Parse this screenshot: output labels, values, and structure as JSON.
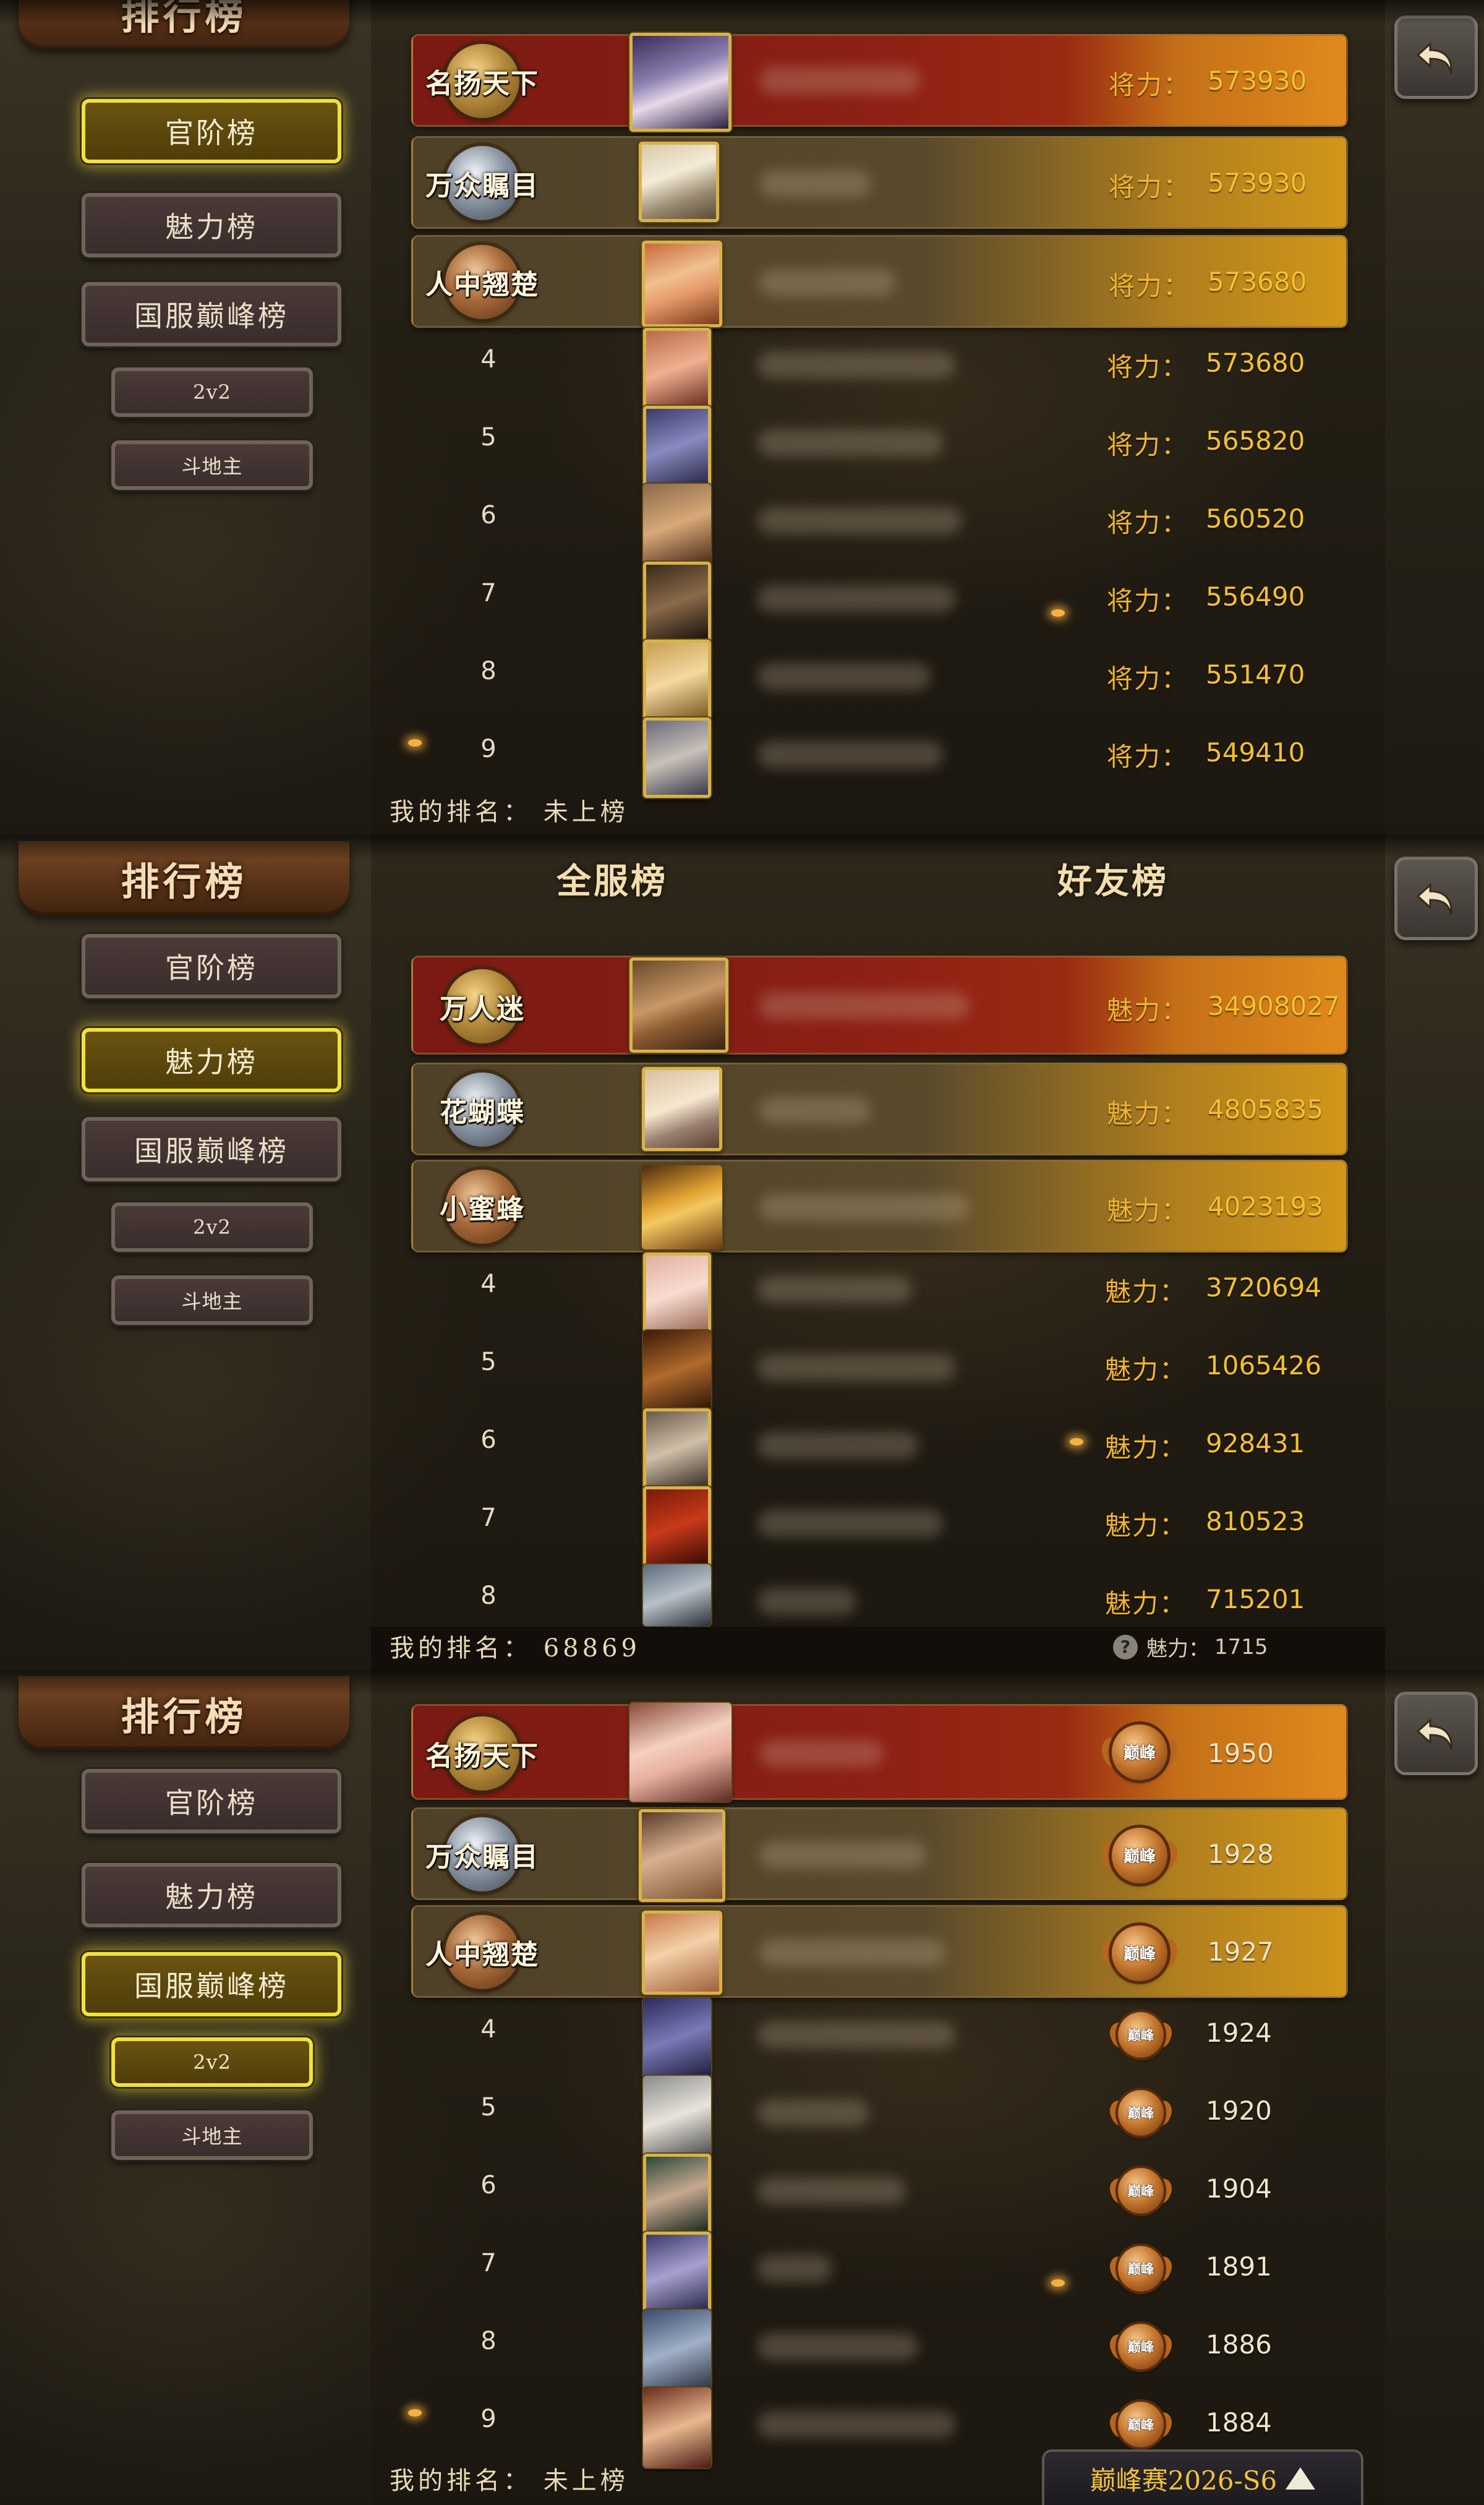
{
  "common": {
    "title": "排行榜",
    "nav": [
      "官阶榜",
      "魅力榜",
      "国服巅峰榜",
      "2v2",
      "斗地主"
    ]
  },
  "panel1": {
    "active": 0,
    "label": "将力：",
    "top_medals": [
      "名扬天下",
      "万众瞩目",
      "人中翘楚"
    ],
    "values": [
      "573930",
      "573930",
      "573680",
      "573680",
      "565820",
      "560520",
      "556490",
      "551470",
      "549410"
    ],
    "my_rank_label": "我的排名：",
    "my_rank_value": "未上榜"
  },
  "panel2": {
    "active": 1,
    "tabs": [
      "全服榜",
      "好友榜"
    ],
    "label": "魅力：",
    "top_medals": [
      "万人迷",
      "花蝴蝶",
      "小蜜蜂"
    ],
    "values": [
      "34908027",
      "4805835",
      "4023193",
      "3720694",
      "1065426",
      "928431",
      "810523",
      "715201"
    ],
    "my_rank_label": "我的排名：",
    "my_rank_value": "68869",
    "footer_charm_label": "魅力：",
    "footer_charm_value": "1715",
    "help_icon": "?"
  },
  "panel3": {
    "active": 2,
    "active_sub": 3,
    "badge_text": "巅峰",
    "top_medals": [
      "名扬天下",
      "万众瞩目",
      "人中翘楚"
    ],
    "values": [
      "1950",
      "1928",
      "1927",
      "1924",
      "1920",
      "1904",
      "1891",
      "1886",
      "1884"
    ],
    "my_rank_label": "我的排名：",
    "my_rank_value": "未上榜",
    "season": "巅峰赛2026-S6"
  },
  "rank_numbers": [
    "4",
    "5",
    "6",
    "7",
    "8",
    "9"
  ],
  "colors": {
    "highlight": "#f0e23a",
    "value_gold": "#f4c030",
    "row1_red": "#8e2015",
    "button_bg": "#3a2d2c"
  },
  "icons": {
    "back": "back-arrow-icon",
    "help": "question-icon",
    "season_toggle": "triangle-up-icon"
  }
}
